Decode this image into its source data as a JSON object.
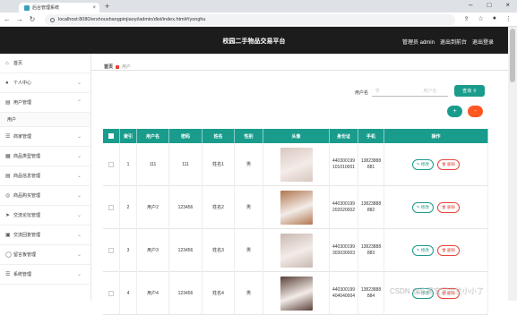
{
  "browser": {
    "tab_title": "后台管理系统",
    "url": "localhost:8080/ershoushangpinjiaoyi/admin/dist/index.html#/yonghu"
  },
  "app": {
    "title": "校园二手物品交易平台",
    "user_label": "管理员 admin",
    "back_link": "退出到前台",
    "logout": "退出登录"
  },
  "sidebar": {
    "items": [
      {
        "label": "首页",
        "icon": "home-icon",
        "chev": false
      },
      {
        "label": "个人中心",
        "icon": "user-icon",
        "chev": true
      },
      {
        "label": "用户管理",
        "icon": "users-icon",
        "chev": true,
        "open": true
      },
      {
        "label": "用户",
        "sub": true
      },
      {
        "label": "商家管理",
        "icon": "shop-icon",
        "chev": true
      },
      {
        "label": "商品类型管理",
        "icon": "list-icon",
        "chev": true
      },
      {
        "label": "商品信息管理",
        "icon": "info-icon",
        "chev": true
      },
      {
        "label": "商品购买管理",
        "icon": "cart-icon",
        "chev": true
      },
      {
        "label": "交流论坛管理",
        "icon": "forum-icon",
        "chev": true
      },
      {
        "label": "交流回复管理",
        "icon": "reply-icon",
        "chev": true
      },
      {
        "label": "留言板管理",
        "icon": "message-icon",
        "chev": true
      },
      {
        "label": "系统管理",
        "icon": "settings-icon",
        "chev": true
      }
    ]
  },
  "breadcrumb": {
    "home": "首页",
    "current": "用户"
  },
  "search": {
    "label": "用户名",
    "placeholder": "用户名",
    "button": "查询"
  },
  "actions": {
    "add": "+",
    "delete": "-"
  },
  "table": {
    "headers": [
      "",
      "索引",
      "用户名",
      "密码",
      "姓名",
      "性别",
      "头像",
      "身份证",
      "手机",
      "操作"
    ],
    "rows": [
      {
        "index": "1",
        "username": "111",
        "password": "111",
        "name": "姓名1",
        "gender": "男",
        "idcard": "440300199101010001",
        "phone": "13823888881",
        "avatar_color": "#d9c7c0"
      },
      {
        "index": "2",
        "username": "用户2",
        "password": "123456",
        "name": "姓名2",
        "gender": "男",
        "idcard": "440300199202020002",
        "phone": "13823888882",
        "avatar_color": "#b07650"
      },
      {
        "index": "3",
        "username": "用户3",
        "password": "123456",
        "name": "姓名3",
        "gender": "男",
        "idcard": "440300199303030003",
        "phone": "13823888883",
        "avatar_color": "#c9b8b2"
      },
      {
        "index": "4",
        "username": "用户4",
        "password": "123456",
        "name": "姓名4",
        "gender": "男",
        "idcard": "440300199404040004",
        "phone": "13823888884",
        "avatar_color": "#5a4038"
      }
    ],
    "edit_label": "修改",
    "delete_label": "删除"
  },
  "watermark": "CSDN @陈星宝冗兰兰小小了",
  "colors": {
    "accent": "#1a9c8c",
    "danger": "#ff5722",
    "header": "#1c1c1c"
  }
}
